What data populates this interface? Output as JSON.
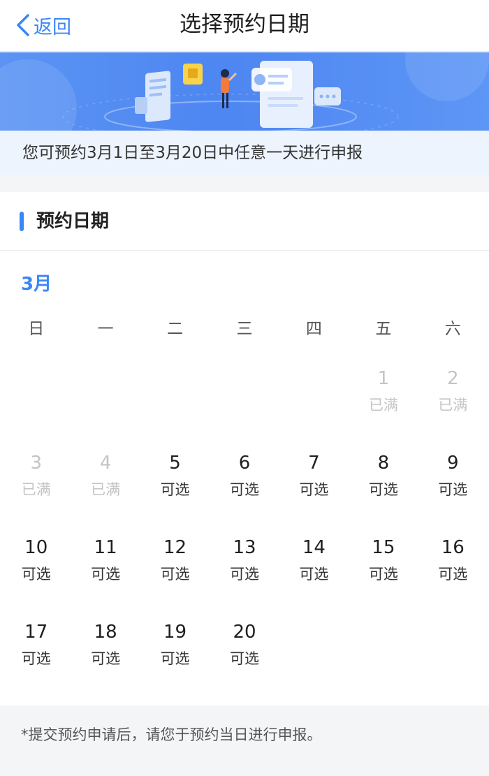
{
  "nav": {
    "back_label": "返回",
    "title": "选择预约日期"
  },
  "notice": {
    "text": "您可预约3月1日至3月20日中任意一天进行申报"
  },
  "section": {
    "title": "预约日期"
  },
  "calendar": {
    "month_label": "3月",
    "weekdays": [
      "日",
      "一",
      "二",
      "三",
      "四",
      "五",
      "六"
    ],
    "leading_blanks": 5,
    "days": [
      {
        "day": "1",
        "status": "已满"
      },
      {
        "day": "2",
        "status": "已满"
      },
      {
        "day": "3",
        "status": "已满"
      },
      {
        "day": "4",
        "status": "已满"
      },
      {
        "day": "5",
        "status": "可选"
      },
      {
        "day": "6",
        "status": "可选"
      },
      {
        "day": "7",
        "status": "可选"
      },
      {
        "day": "8",
        "status": "可选"
      },
      {
        "day": "9",
        "status": "可选"
      },
      {
        "day": "10",
        "status": "可选"
      },
      {
        "day": "11",
        "status": "可选"
      },
      {
        "day": "12",
        "status": "可选"
      },
      {
        "day": "13",
        "status": "可选"
      },
      {
        "day": "14",
        "status": "可选"
      },
      {
        "day": "15",
        "status": "可选"
      },
      {
        "day": "16",
        "status": "可选"
      },
      {
        "day": "17",
        "status": "可选"
      },
      {
        "day": "18",
        "status": "可选"
      },
      {
        "day": "19",
        "status": "可选"
      },
      {
        "day": "20",
        "status": "可选"
      }
    ]
  },
  "footer": {
    "text": "*提交预约申请后，请您于预约当日进行申报。"
  },
  "colors": {
    "accent": "#3a86f6",
    "full": "#c4c4c4",
    "notice_bg": "#edf4fe"
  }
}
